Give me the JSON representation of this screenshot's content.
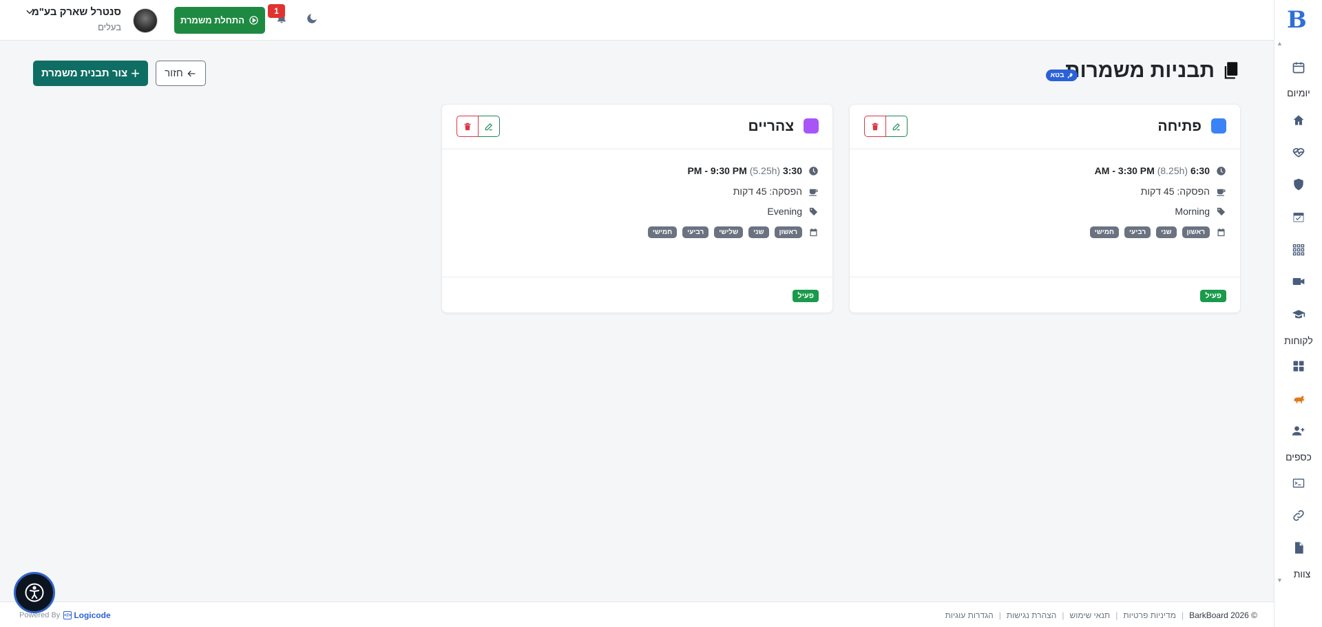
{
  "header": {
    "company_name": "סנטרל שארק בע\"מ",
    "company_role": "בעלים",
    "start_shift_label": "התחלת משמרת",
    "notification_count": "1"
  },
  "sidebar": {
    "items": [
      {
        "icon": "calendar-icon"
      },
      {
        "label": "יומיום"
      },
      {
        "icon": "home-icon"
      },
      {
        "icon": "heart-pulse-icon"
      },
      {
        "icon": "shield-heart-icon"
      },
      {
        "icon": "calendar-check-icon"
      },
      {
        "icon": "grid-dots-icon"
      },
      {
        "icon": "video-icon"
      },
      {
        "icon": "graduation-cap-icon"
      },
      {
        "label": "לקוחות"
      },
      {
        "icon": "apps-icon"
      },
      {
        "icon": "pet-icon"
      },
      {
        "icon": "user-plus-icon"
      },
      {
        "label": "כספים"
      },
      {
        "icon": "terminal-icon"
      },
      {
        "icon": "link-icon"
      },
      {
        "icon": "document-icon"
      },
      {
        "label": "צוות"
      }
    ]
  },
  "page": {
    "title": "תבניות משמרות",
    "beta_label": "בטא",
    "back_label": "חזור",
    "create_label": "צור תבנית משמרת"
  },
  "cards": [
    {
      "name": "פתיחה",
      "color": "#3b82f6",
      "start": "6:30",
      "duration": "(8.25h)",
      "end": "AM - 3:30 PM",
      "break_text": "הפסקה: 45 דקות",
      "tag": "Morning",
      "days": [
        "ראשון",
        "שני",
        "רביעי",
        "חמישי"
      ],
      "status": "פעיל"
    },
    {
      "name": "צהריים",
      "color": "#a855f7",
      "start": "3:30",
      "duration": "(5.25h)",
      "end": "PM - 9:30 PM",
      "break_text": "הפסקה: 45 דקות",
      "tag": "Evening",
      "days": [
        "ראשון",
        "שני",
        "שלישי",
        "רביעי",
        "חמישי"
      ],
      "status": "פעיל"
    }
  ],
  "footer": {
    "copyright": "© BarkBoard 2026",
    "links": [
      "מדיניות פרטיות",
      "תנאי שימוש",
      "הצהרת נגישות",
      "הגדרות עוגיות"
    ],
    "powered_by": "Powered By",
    "powered_brand": "Logicode"
  }
}
